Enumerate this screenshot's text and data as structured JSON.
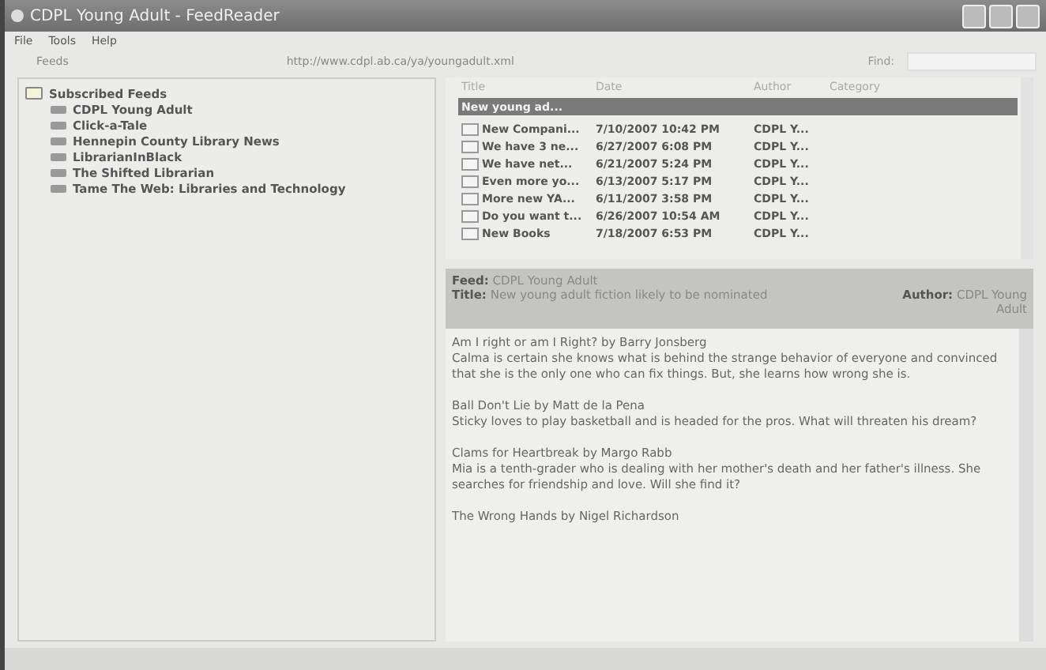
{
  "window": {
    "title": "CDPL Young Adult - FeedReader"
  },
  "menu": [
    "File",
    "Tools",
    "Help"
  ],
  "address": {
    "button": "Feeds",
    "url": "http://www.cdpl.ab.ca/ya/youngadult.xml",
    "find_label": "Find:"
  },
  "tree": {
    "label": "Subscribed Feeds",
    "expanded": true,
    "children": [
      {
        "label": "CDPL Young Adult"
      },
      {
        "label": "Click-a-Tale"
      },
      {
        "label": "Hennepin County Library News"
      },
      {
        "label": "LibrarianInBlack"
      },
      {
        "label": "The Shifted Librarian"
      },
      {
        "label": "Tame The Web: Libraries and Technology"
      }
    ]
  },
  "list": {
    "columns": [
      "Title",
      "Date",
      "Author",
      "Category"
    ],
    "rows": [
      {
        "title": "New young ad...",
        "selected": true
      },
      {
        "title": "New Compani...",
        "date": "7/10/2007 10:42 PM",
        "author": "CDPL Y...",
        "selected": false
      },
      {
        "title": "We have 3 ne...",
        "date": "6/27/2007 6:08 PM",
        "author": "CDPL Y...",
        "selected": false
      },
      {
        "title": "We have net...",
        "date": "6/21/2007 5:24 PM",
        "author": "CDPL Y...",
        "selected": false
      },
      {
        "title": "Even more yo...",
        "date": "6/13/2007 5:17 PM",
        "author": "CDPL Y...",
        "selected": false
      },
      {
        "title": "More new YA...",
        "date": "6/11/2007 3:58 PM",
        "author": "CDPL Y...",
        "selected": false
      },
      {
        "title": "Do you want t...",
        "date": "6/26/2007 10:54 AM",
        "author": "CDPL Y...",
        "selected": false
      },
      {
        "title": "New Books",
        "date": "7/18/2007 6:53 PM",
        "author": "CDPL Y...",
        "selected": false
      }
    ]
  },
  "detail": {
    "feed_label": "Feed:",
    "feed": "CDPL Young Adult",
    "title_label": "Title:",
    "title": "New young adult fiction likely to be nominated",
    "author_label": "Author:",
    "author": "CDPL Young Adult",
    "paragraphs": [
      {
        "heading": "Am I right or am I Right? by Barry Jonsberg",
        "text": "Calma is certain she knows what is behind the strange behavior of everyone and convinced that she is the only one who can fix things. But, she learns how wrong she is."
      },
      {
        "heading": "Ball Don't Lie by Matt de la Pena",
        "text": "Sticky loves to play basketball and is headed for the pros. What will threaten his dream?"
      },
      {
        "heading": "Clams for Heartbreak by Margo Rabb",
        "text": "Mia is a tenth-grader who is dealing with her mother's death and her father's illness. She searches for friendship and love. Will she find it?"
      },
      {
        "heading": "The Wrong Hands by Nigel Richardson"
      }
    ]
  }
}
